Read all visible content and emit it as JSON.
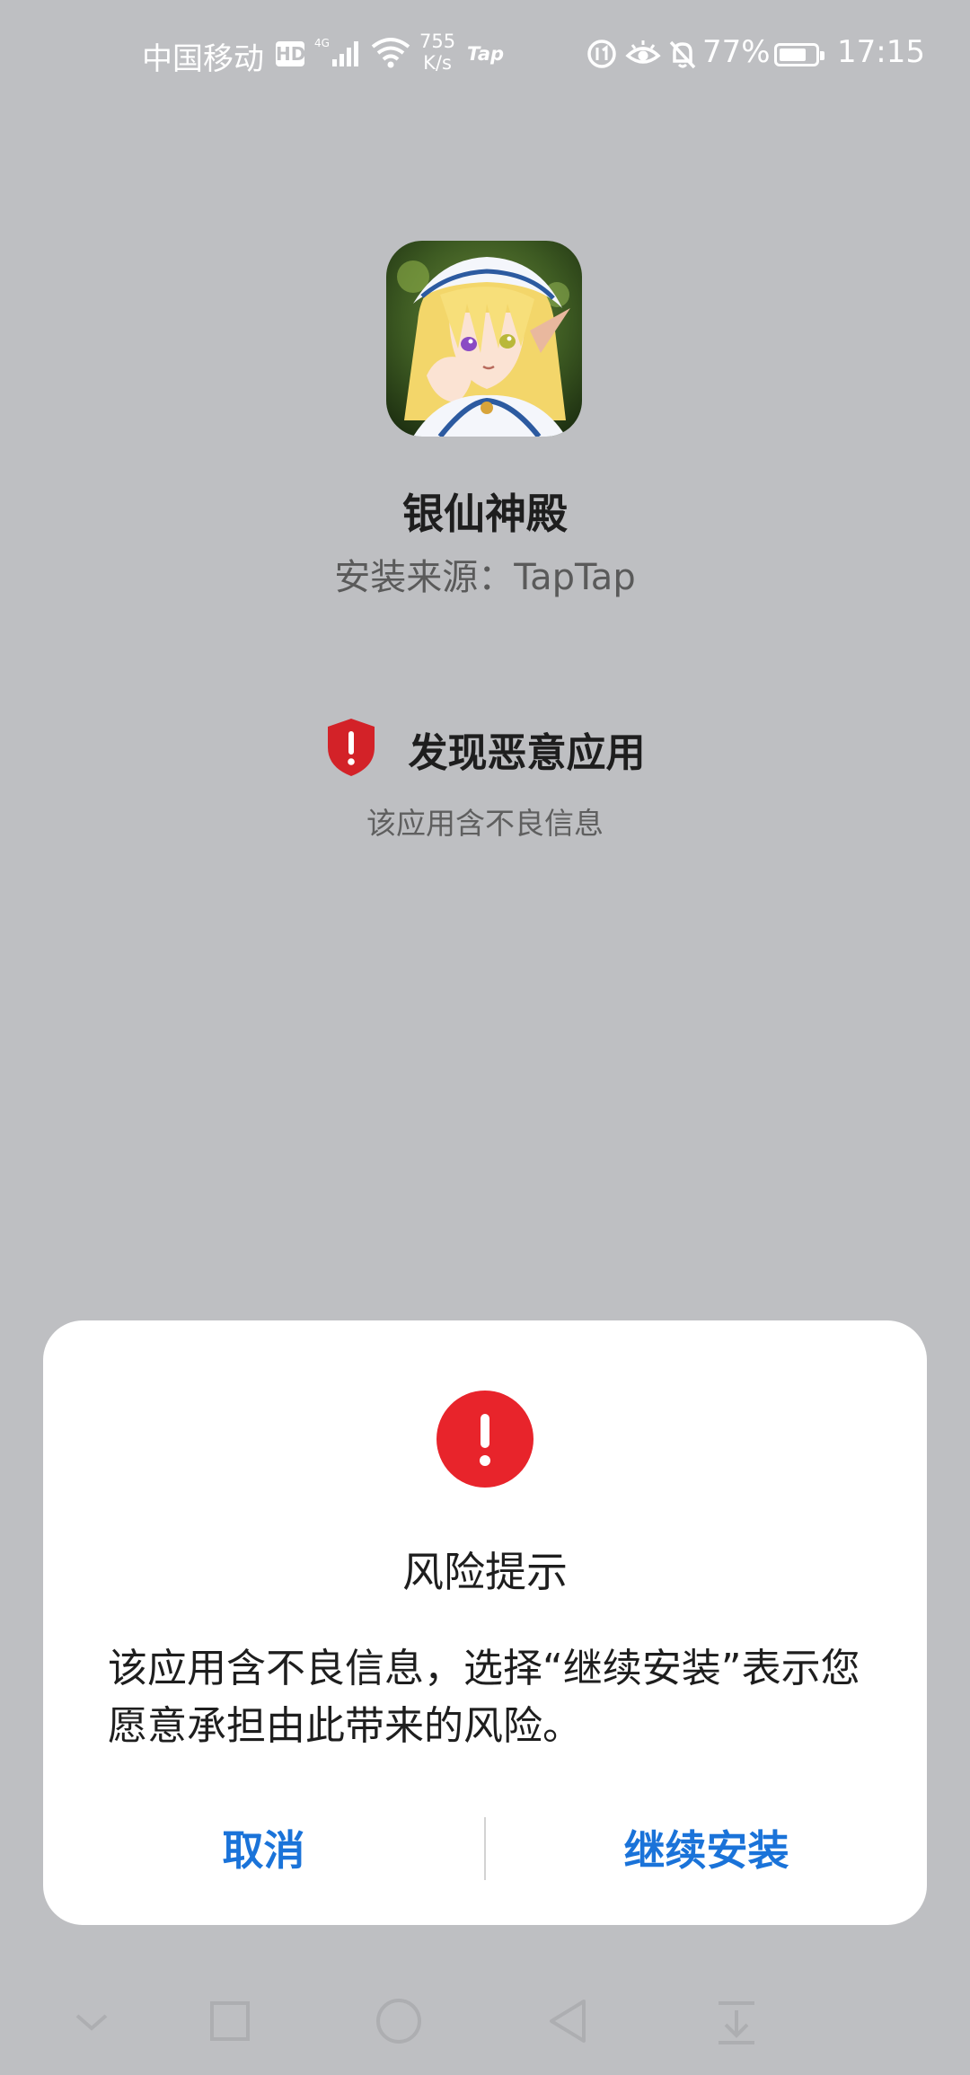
{
  "status_bar": {
    "carrier": "中国移动",
    "hd_badge": "HD",
    "network_type": "4G",
    "net_speed_value": "755",
    "net_speed_unit": "K/s",
    "tap_label": "Tap",
    "battery_percent": "77%",
    "battery_level": 0.77,
    "time": "17:15"
  },
  "app": {
    "name": "银仙神殿",
    "install_source": "安装来源：TapTap"
  },
  "warning": {
    "title": "发现恶意应用",
    "subtitle": "该应用含不良信息"
  },
  "dialog": {
    "title": "风险提示",
    "message": "该应用含不良信息，选择“继续安装”表示您愿意承担由此带来的风险。",
    "cancel_label": "取消",
    "continue_label": "继续安装"
  },
  "nav_bar": {
    "icons": [
      "chevron-down-icon",
      "square-icon",
      "circle-home-icon",
      "triangle-back-icon",
      "download-icon"
    ]
  },
  "colors": {
    "background": "#bebfc2",
    "accent_blue": "#1a73d9",
    "alert_red": "#e8242b",
    "shield_red": "#d32228"
  }
}
